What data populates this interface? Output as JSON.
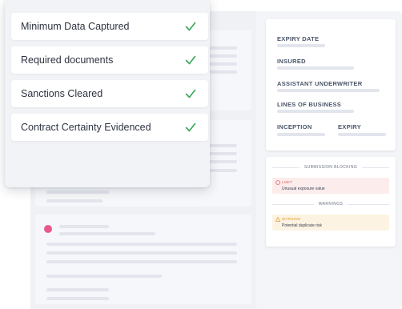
{
  "checklist": {
    "items": [
      {
        "label": "Minimum Data Captured",
        "status": "complete"
      },
      {
        "label": "Required documents",
        "status": "complete"
      },
      {
        "label": "Sanctions Cleared",
        "status": "complete"
      },
      {
        "label": "Contract Certainty Evidenced",
        "status": "complete"
      }
    ],
    "check_color": "#3aa55c"
  },
  "details": {
    "expiry_date_label": "EXPIRY DATE",
    "insured_label": "INSURED",
    "assistant_underwriter_label": "ASSISTANT UNDERWRITER",
    "lines_of_business_label": "LINES OF BUSINESS",
    "inception_label": "INCEPTION",
    "expiry_label": "EXPIRY"
  },
  "blocking": {
    "heading": "SUBMISSION BLOCKING",
    "limit_tag": "LIMIT",
    "limit_message": "Unusual exposure value",
    "limit_color": "#e05a5a",
    "warnings_heading": "WARNINGS",
    "warning_tag": "WARNING",
    "warning_message": "Potential duplicate risk",
    "warning_color": "#e09a2e"
  },
  "colors": {
    "accent_pink": "#e8588a"
  }
}
